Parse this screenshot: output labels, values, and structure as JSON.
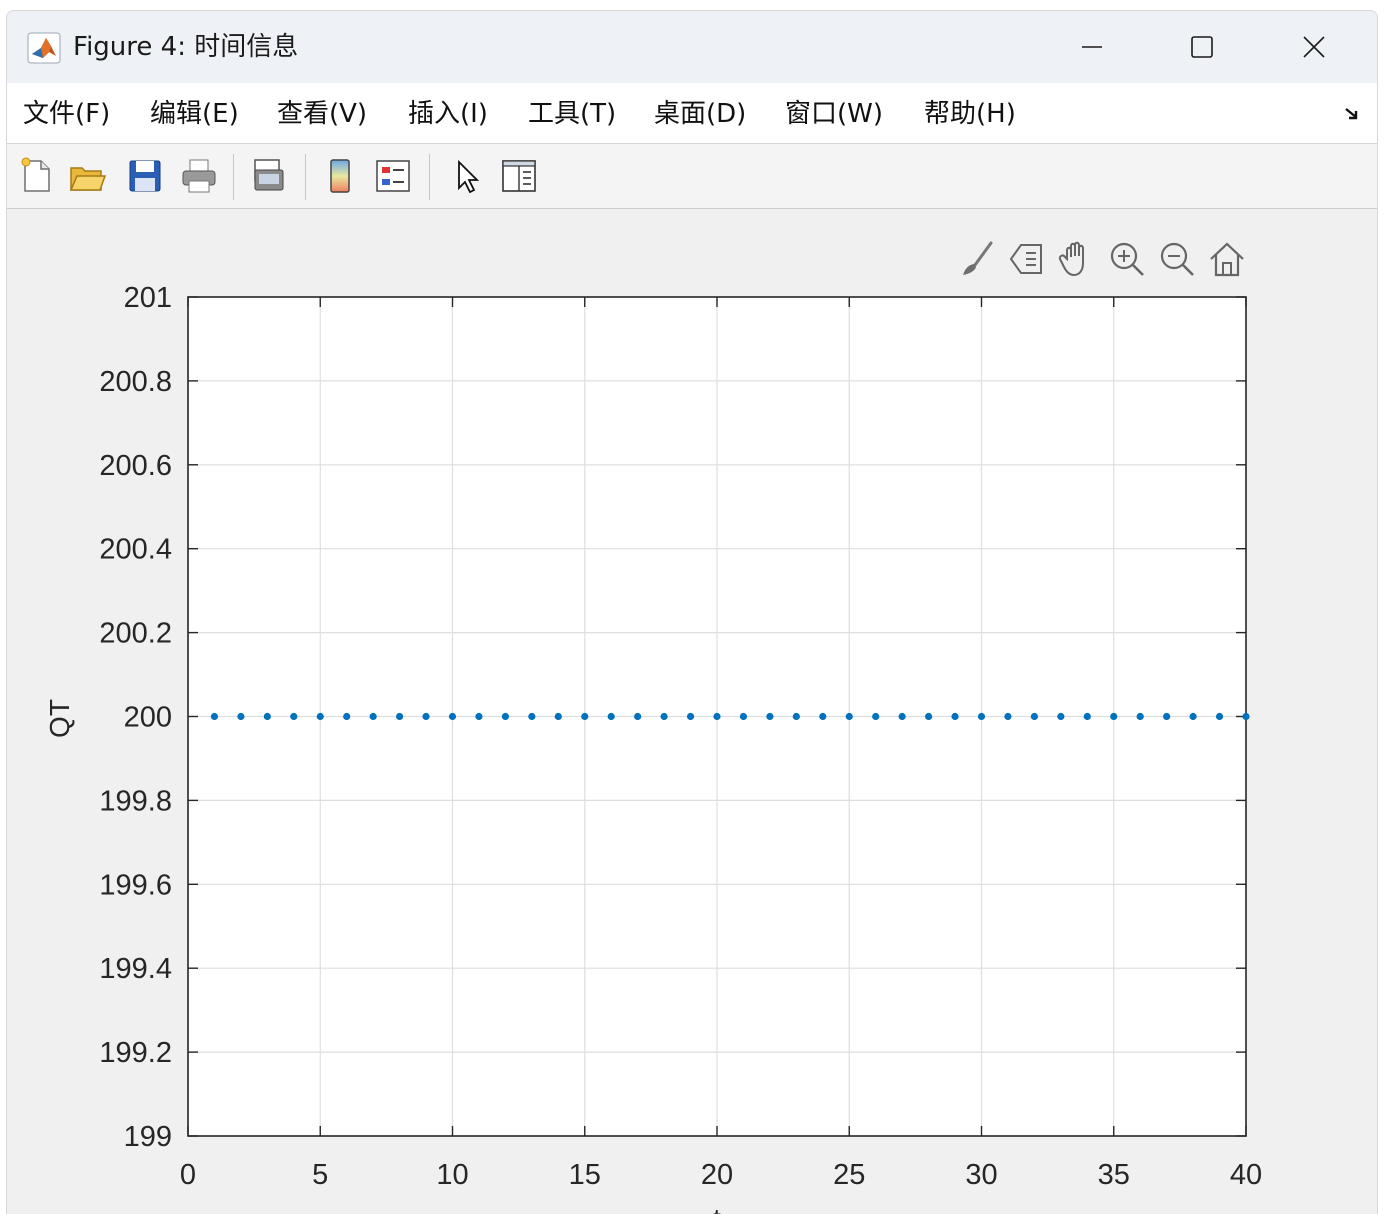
{
  "window": {
    "title": "Figure 4: 时间信息",
    "controls": [
      "minimize",
      "maximize",
      "close"
    ]
  },
  "menu": {
    "items": [
      "文件(F)",
      "编辑(E)",
      "查看(V)",
      "插入(I)",
      "工具(T)",
      "桌面(D)",
      "窗口(W)",
      "帮助(H)"
    ]
  },
  "toolbar": {
    "icons": [
      "new-figure-icon",
      "open-file-icon",
      "save-icon",
      "print-icon",
      "link-plot-icon",
      "insert-colorbar-icon",
      "insert-legend-icon",
      "edit-plot-icon",
      "property-inspector-icon"
    ]
  },
  "axes_toolbar": {
    "icons": [
      "brush-icon",
      "data-tips-icon",
      "pan-icon",
      "zoom-in-icon",
      "zoom-out-icon",
      "restore-view-icon"
    ]
  },
  "colors": {
    "marker": "#0072bd",
    "grid": "#dedede",
    "axes_frame": "#262626"
  },
  "chart_data": {
    "type": "scatter",
    "xlabel": "t",
    "ylabel": "QT",
    "xlim": [
      0,
      40
    ],
    "ylim": [
      199,
      201
    ],
    "xticks": [
      "0",
      "5",
      "10",
      "15",
      "20",
      "25",
      "30",
      "35",
      "40"
    ],
    "yticks": [
      "199",
      "199.2",
      "199.4",
      "199.6",
      "199.8",
      "200",
      "200.2",
      "200.4",
      "200.6",
      "200.8",
      "201"
    ],
    "grid": true,
    "series": [
      {
        "marker": "point",
        "x": [
          1,
          2,
          3,
          4,
          5,
          6,
          7,
          8,
          9,
          10,
          11,
          12,
          13,
          14,
          15,
          16,
          17,
          18,
          19,
          20,
          21,
          22,
          23,
          24,
          25,
          26,
          27,
          28,
          29,
          30,
          31,
          32,
          33,
          34,
          35,
          36,
          37,
          38,
          39,
          40
        ],
        "y": [
          200,
          200,
          200,
          200,
          200,
          200,
          200,
          200,
          200,
          200,
          200,
          200,
          200,
          200,
          200,
          200,
          200,
          200,
          200,
          200,
          200,
          200,
          200,
          200,
          200,
          200,
          200,
          200,
          200,
          200,
          200,
          200,
          200,
          200,
          200,
          200,
          200,
          200,
          200,
          200
        ]
      }
    ]
  }
}
